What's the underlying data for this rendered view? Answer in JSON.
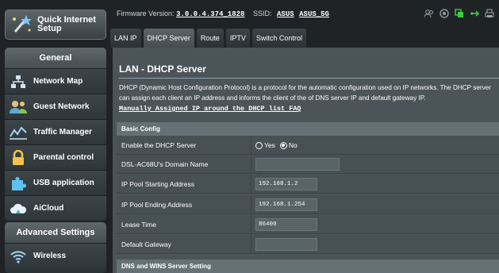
{
  "quick_setup": {
    "label": "Quick Internet Setup"
  },
  "general": {
    "heading": "General",
    "items": [
      {
        "label": "Network Map",
        "icon": "network-map-icon"
      },
      {
        "label": "Guest Network",
        "icon": "guest-network-icon"
      },
      {
        "label": "Traffic Manager",
        "icon": "traffic-manager-icon"
      },
      {
        "label": "Parental control",
        "icon": "lock-icon"
      },
      {
        "label": "USB application",
        "icon": "puzzle-icon"
      },
      {
        "label": "AiCloud",
        "icon": "cloud-icon"
      }
    ]
  },
  "advanced": {
    "heading": "Advanced Settings",
    "items": [
      {
        "label": "Wireless",
        "icon": "wifi-icon"
      }
    ]
  },
  "topbar": {
    "firmware_label": "Firmware Version:",
    "firmware_value": "3.0.0.4.374_1828",
    "ssid_label": "SSID:",
    "ssid_1": "ASUS",
    "ssid_2": "ASUS_5G",
    "accent": "#3ad13a"
  },
  "tabs": [
    {
      "label": "LAN IP",
      "active": false
    },
    {
      "label": "DHCP Server",
      "active": true
    },
    {
      "label": "Route",
      "active": false
    },
    {
      "label": "IPTV",
      "active": false
    },
    {
      "label": "Switch Control",
      "active": false
    }
  ],
  "main": {
    "title": "LAN - DHCP Server",
    "description": "DHCP (Dynamic Host Configuration Protocol) is a protocol for the automatic configuration used on IP networks. The DHCP server can assign each client an IP address and informs the client of the of DNS server IP and default gateway IP.",
    "faq_link": "Manually Assigned IP around the DHCP list FAQ",
    "basic_config_heading": "Basic Config",
    "rows": [
      {
        "label": "Enable the DHCP Server",
        "type": "radio",
        "options": [
          "Yes",
          "No"
        ],
        "selected": "No"
      },
      {
        "label": "DSL-AC68U's Domain Name",
        "type": "input",
        "value": ""
      },
      {
        "label": "IP Pool Starting Address",
        "type": "input",
        "value": "192.168.1.2"
      },
      {
        "label": "IP Pool Ending Address",
        "type": "input",
        "value": "192.168.1.254"
      },
      {
        "label": "Lease Time",
        "type": "input",
        "value": "86400"
      },
      {
        "label": "Default Gateway",
        "type": "input",
        "value": ""
      }
    ],
    "dns_heading": "DNS and WINS Server Setting"
  }
}
